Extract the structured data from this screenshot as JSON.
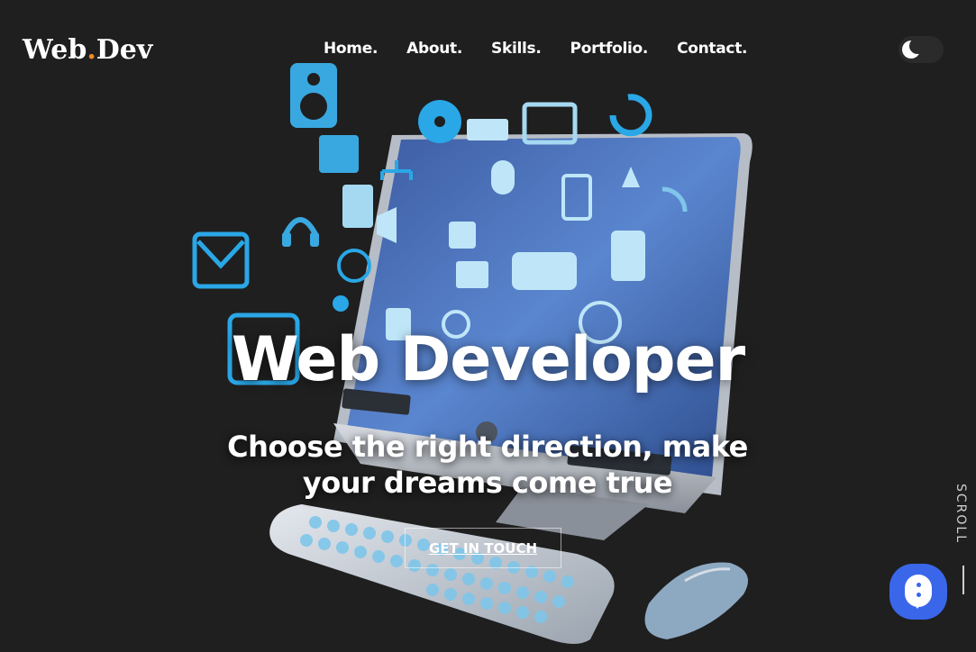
{
  "brand": {
    "logo_part1": "Web",
    "logo_dot": ".",
    "logo_part2": "Dev",
    "accent_color": "#f08a24"
  },
  "nav": {
    "items": [
      {
        "label": "Home."
      },
      {
        "label": "About."
      },
      {
        "label": "Skills."
      },
      {
        "label": "Portfolio."
      },
      {
        "label": "Contact."
      }
    ]
  },
  "theme_toggle": {
    "icon": "moon-icon",
    "state": "dark"
  },
  "hero": {
    "title": "Web Developer",
    "subtitle_line1": "Choose the right direction, make",
    "subtitle_line2": "your dreams come true",
    "cta_label": "GET IN TOUCH"
  },
  "scroll": {
    "label": "SCROLL"
  },
  "chat_widget": {
    "icon": "chat-bubble-icon",
    "color": "#3a66ea"
  },
  "colors": {
    "background": "#1f1f1f",
    "icon_blue": "#2aa7e6",
    "screen_blue": "#4a74c4"
  }
}
